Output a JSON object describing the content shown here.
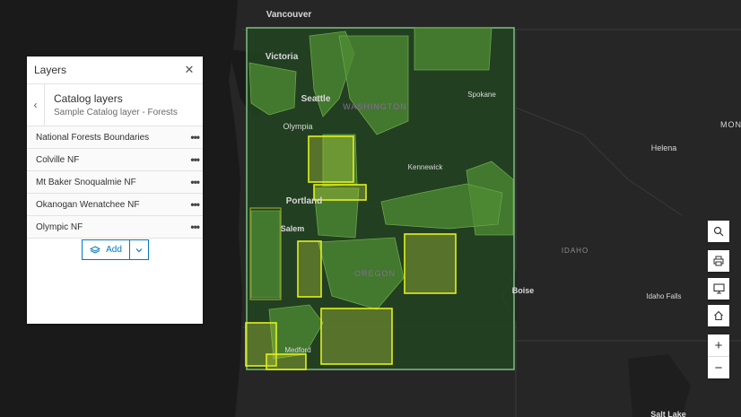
{
  "map": {
    "places": {
      "vancouver": "Vancouver",
      "victoria": "Victoria",
      "seattle": "Seattle",
      "washington": "WASHINGTON",
      "spokane": "Spokane",
      "olympia": "Olympia",
      "helena": "Helena",
      "montana": "MON",
      "kennewick": "Kennewick",
      "portland": "Portland",
      "salem": "Salem",
      "idaho": "IDAHO",
      "oregon": "OREGON",
      "boise": "Boise",
      "idaho_falls": "Idaho Falls",
      "medford": "Medford",
      "salt_lake": "Salt Lake"
    }
  },
  "panel": {
    "title": "Layers",
    "close_icon": "close-icon",
    "catalog": {
      "title": "Catalog layers",
      "subtitle": "Sample Catalog layer - Forests"
    },
    "layers": [
      {
        "name": "National Forests Boundaries"
      },
      {
        "name": "Colville NF"
      },
      {
        "name": "Mt Baker Snoqualmie NF"
      },
      {
        "name": "Okanogan Wenatchee NF"
      },
      {
        "name": "Olympic NF"
      }
    ],
    "more_glyph": "•••",
    "add_label": "Add"
  },
  "toolbar": {
    "zoom_in": "+",
    "zoom_out": "−"
  },
  "colors": {
    "map_background": "#262626",
    "catalog_extent": "#2b5a2b",
    "forest_fill": "#4f8c34",
    "highlight": "#e2f01d",
    "accent": "#007ac2"
  }
}
